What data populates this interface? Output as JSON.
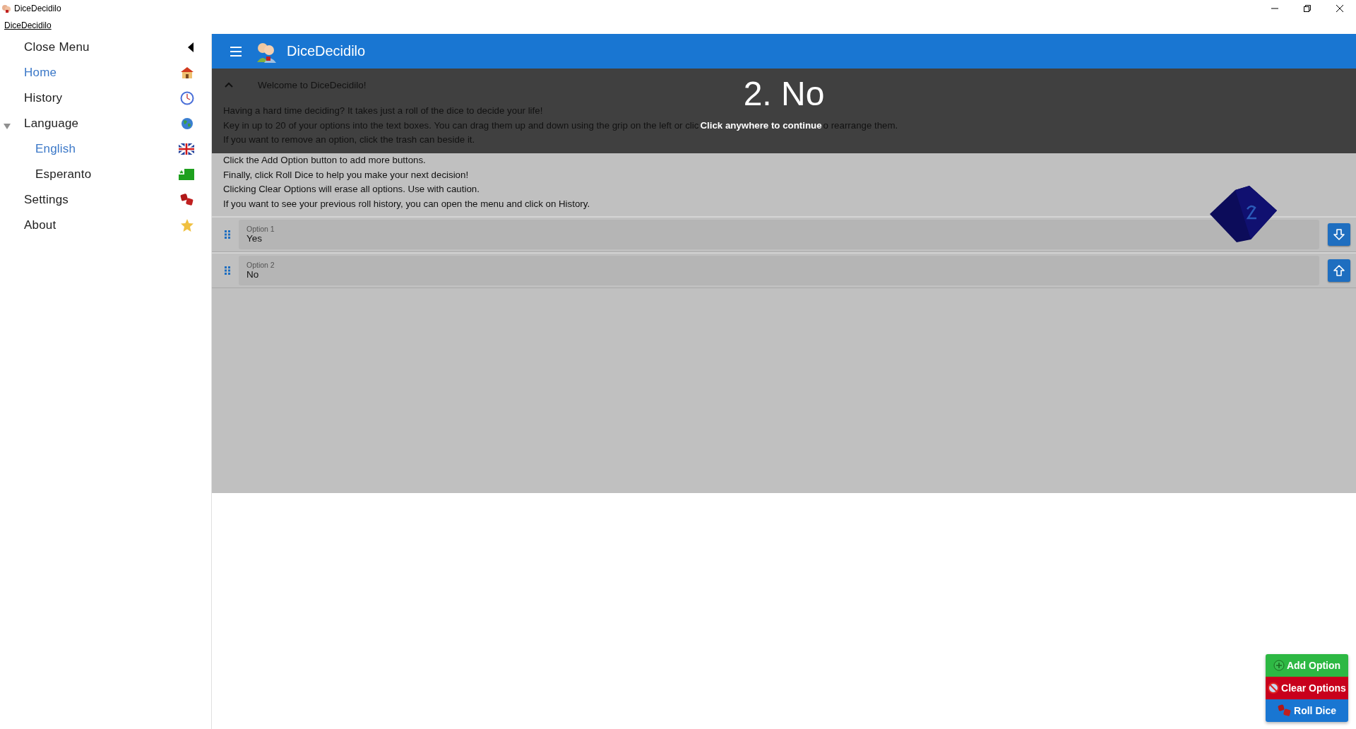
{
  "window": {
    "title": "DiceDecidilo"
  },
  "menu_bar": {
    "label": "DiceDecidilo"
  },
  "sidebar": {
    "items": [
      {
        "label": "Close Menu",
        "selected": false
      },
      {
        "label": "Home",
        "selected": true
      },
      {
        "label": "History",
        "selected": false
      },
      {
        "label": "Language",
        "selected": false,
        "expanded": true,
        "children": [
          {
            "label": "English",
            "selected": true
          },
          {
            "label": "Esperanto",
            "selected": false
          }
        ]
      },
      {
        "label": "Settings",
        "selected": false
      },
      {
        "label": "About",
        "selected": false
      }
    ]
  },
  "header": {
    "title": "DiceDecidilo"
  },
  "welcome": {
    "title": "Welcome to DiceDecidilo!",
    "expanded": true,
    "lines": [
      {
        "text": "Having a hard time deciding? It takes just a roll of the dice to decide your life!"
      },
      {
        "text": "Key in up to 20 of your options into the text boxes. You can drag them up and down using the grip on the left or clic",
        "text_after": "o rearrange them."
      },
      {
        "text": "If you want to remove an option, click the trash can beside it."
      },
      {
        "text": "Click the Add Option button to add more buttons."
      },
      {
        "text": "Finally, click Roll Dice to help you make your next decision!"
      },
      {
        "text": "Clicking Clear Options will erase all options. Use with caution."
      },
      {
        "text": "If you want to see your previous roll history, you can open the menu and click on History."
      }
    ]
  },
  "result": {
    "title": "2. No",
    "hint": "Click anywhere to continue"
  },
  "options": [
    {
      "label": "Option 1",
      "value": "Yes",
      "kind": "down"
    },
    {
      "label": "Option 2",
      "value": "No",
      "kind": "up"
    }
  ],
  "actions": [
    {
      "label": "Add Option",
      "kind": "add"
    },
    {
      "label": "Clear Options",
      "kind": "clear"
    },
    {
      "label": "Roll Dice",
      "kind": "roll"
    }
  ]
}
